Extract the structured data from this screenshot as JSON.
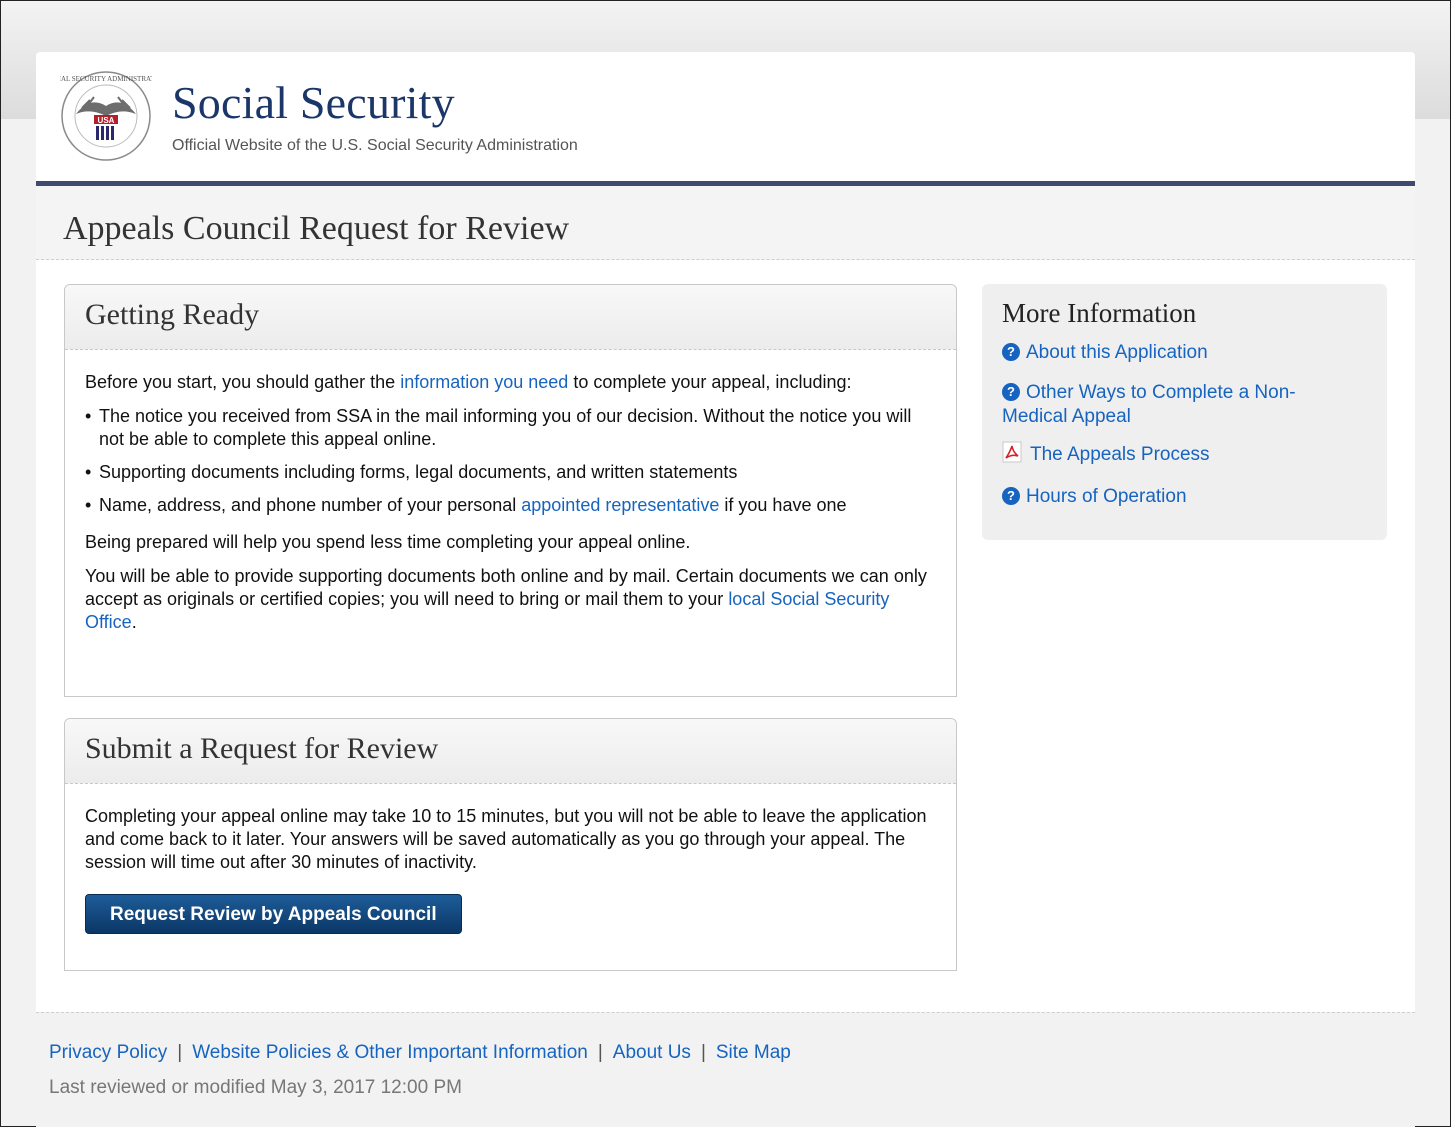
{
  "header": {
    "seal_text": "SOCIAL SECURITY ADMINISTRATION",
    "seal_badge": "USA",
    "brand_title": "Social Security",
    "brand_subtitle": "Official Website of the U.S. Social Security Administration"
  },
  "page_title": "Appeals Council Request for Review",
  "getting_ready": {
    "heading": "Getting Ready",
    "intro_before": "Before you start, you should gather the ",
    "intro_link": "information you need",
    "intro_after": " to complete your appeal, including:",
    "bullet_1": "The notice you received from SSA in the mail informing you of our decision. Without the notice you will not be able to complete this appeal online.",
    "bullet_2": "Supporting documents including forms, legal documents, and written statements",
    "bullet_3_before": "Name, address, and phone number of your personal ",
    "bullet_3_link": "appointed representative",
    "bullet_3_after": " if you have one",
    "para_prepared": "Being prepared will help you spend less time completing your appeal online.",
    "para_docs_before": "You will be able to provide supporting documents both online and by mail. Certain documents we can only accept as originals or certified copies; you will need to bring or mail them to your ",
    "para_docs_link": "local Social Security Office",
    "para_docs_after": "."
  },
  "submit": {
    "heading": "Submit a Request for Review",
    "text": "Completing your appeal online may take 10 to 15 minutes, but you will not be able to leave the application and come back to it later. Your answers will be saved automatically as you go through your appeal. The session will time out after 30 minutes of inactivity.",
    "button_label": "Request Review by Appeals Council"
  },
  "sidebar": {
    "heading": "More Information",
    "links": [
      {
        "label": "About this Application",
        "icon": "help-icon"
      },
      {
        "label": "Other Ways to Complete a Non-Medical Appeal",
        "icon": "help-icon"
      },
      {
        "label": "The Appeals Process",
        "icon": "pdf-icon"
      },
      {
        "label": "Hours of Operation",
        "icon": "help-icon"
      }
    ]
  },
  "footer": {
    "links": [
      "Privacy Policy",
      "Website Policies & Other Important Information",
      "About Us",
      "Site Map"
    ],
    "separator": "|",
    "last_reviewed": "Last reviewed or modified May 3, 2017 12:00 PM"
  },
  "colors": {
    "brand_navy": "#1b3668",
    "header_rule": "#3e4a6e",
    "link_blue": "#1664c0",
    "button_blue": "#0b3766"
  }
}
